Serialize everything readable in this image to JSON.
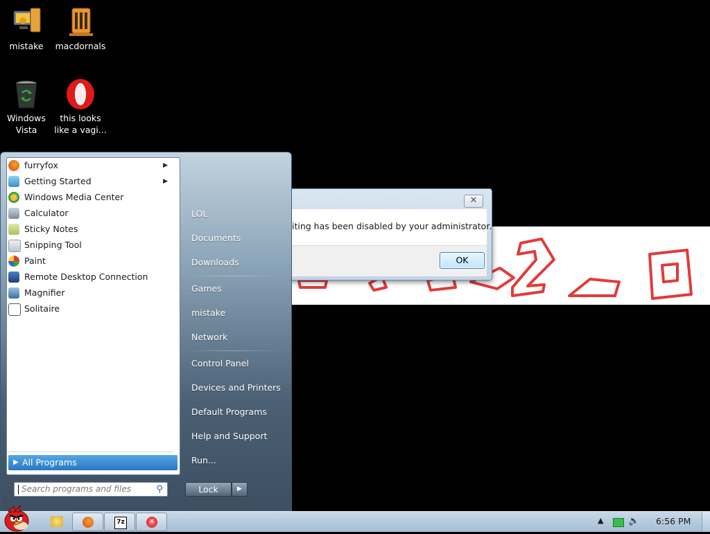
{
  "desktop": {
    "icons": [
      {
        "label_line1": "mistake",
        "label_line2": "",
        "icon": "computer-folder-icon"
      },
      {
        "label_line1": "macdornals",
        "label_line2": "",
        "icon": "book-folder-icon"
      },
      {
        "label_line1": "Windows",
        "label_line2": "Vista",
        "icon": "recycle-bin-icon"
      },
      {
        "label_line1": "this looks",
        "label_line2": "like a vagi...",
        "icon": "opera-icon"
      }
    ]
  },
  "dialog": {
    "message": "iting has been disabled by your administrator.",
    "ok_label": "OK",
    "close_glyph": "✕"
  },
  "start_menu": {
    "programs": [
      {
        "label": "furryfox",
        "has_submenu": true,
        "icon": "firefox-icon"
      },
      {
        "label": "Getting Started",
        "has_submenu": true,
        "icon": "getting-started-icon"
      },
      {
        "label": "Windows Media Center",
        "has_submenu": false,
        "icon": "media-center-icon"
      },
      {
        "label": "Calculator",
        "has_submenu": false,
        "icon": "calculator-icon"
      },
      {
        "label": "Sticky Notes",
        "has_submenu": false,
        "icon": "sticky-notes-icon"
      },
      {
        "label": "Snipping Tool",
        "has_submenu": false,
        "icon": "snipping-tool-icon"
      },
      {
        "label": "Paint",
        "has_submenu": false,
        "icon": "paint-icon"
      },
      {
        "label": "Remote Desktop Connection",
        "has_submenu": false,
        "icon": "remote-desktop-icon"
      },
      {
        "label": "Magnifier",
        "has_submenu": false,
        "icon": "magnifier-icon"
      },
      {
        "label": "Solitaire",
        "has_submenu": false,
        "icon": "solitaire-icon"
      }
    ],
    "all_programs_label": "All Programs",
    "search_placeholder": "Search programs and files",
    "right_items": {
      "lol": "LOL",
      "documents": "Documents",
      "downloads": "Downloads",
      "games": "Games",
      "mistake": "mistake",
      "network": "Network",
      "control_panel": "Control Panel",
      "devices_printers": "Devices and Printers",
      "default_programs": "Default Programs",
      "help_support": "Help and Support",
      "run": "Run..."
    },
    "lock_label": "Lock"
  },
  "taskbar": {
    "pinned": [
      "explorer-icon",
      "firefox-icon",
      "7zip-icon",
      "error-app-icon"
    ],
    "sevenzip_text": "7z",
    "clock": "6:56 PM"
  },
  "colors": {
    "banner_text": "#e23a3a",
    "selection": "#2a77c4"
  }
}
